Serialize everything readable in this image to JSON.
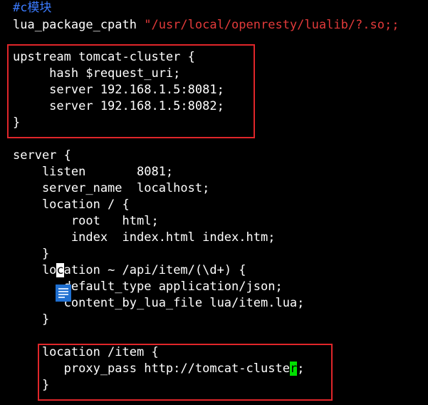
{
  "colors": {
    "background": "#000000",
    "text": "#ffffff",
    "comment": "#3b7bff",
    "string": "#e23a3a",
    "highlight_box": "#e0262a",
    "cursor_green": "#00e000"
  },
  "editor": {
    "lines": {
      "l1": "#c模块",
      "l2a": "lua_package_cpath ",
      "l2b": "\"/usr/local/openresty/lualib/?.so;;",
      "l3": "upstream tomcat-cluster {",
      "l4": "     hash $request_uri;",
      "l5": "     server 192.168.1.5:8081;",
      "l6": "     server 192.168.1.5:8082;",
      "l7": "}",
      "l8": "server {",
      "l9": "    listen       8081;",
      "l10": "    server_name  localhost;",
      "l11": "    location / {",
      "l12": "        root   html;",
      "l13": "        index  index.html index.htm;",
      "l14": "    }",
      "l15a": "    lo",
      "l15b": "c",
      "l15c": "ation ~ /api/item/(\\d+) {",
      "l16": "       default_type application/json;",
      "l17": "       content_by_lua_file lua/item.lua;",
      "l18": "    }",
      "l19": "    location /item {",
      "l20a": "       proxy_pass http://tomcat-cluste",
      "l20b": "r",
      "l20c": ";",
      "l21": "    }"
    }
  },
  "icons": {
    "floating_doc": "document-icon"
  }
}
